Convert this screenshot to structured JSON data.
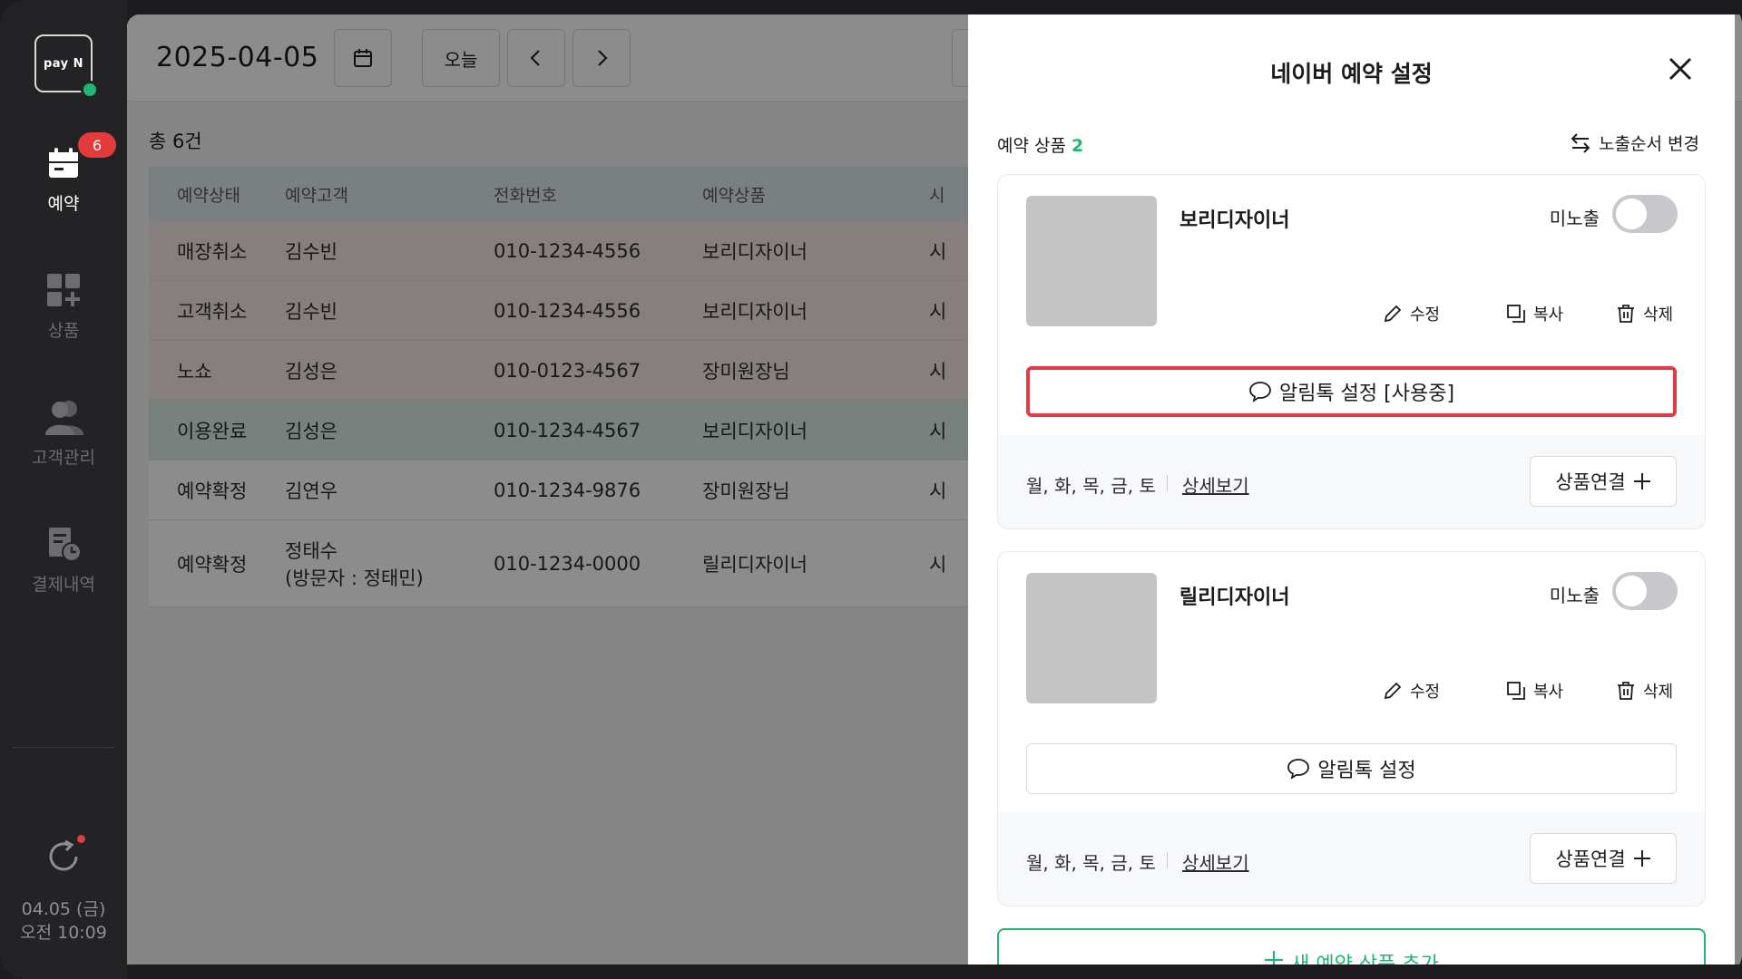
{
  "sidebar": {
    "logo": "pay N",
    "nav": [
      {
        "label": "예약",
        "icon": "calendar-icon",
        "badge": "6",
        "active": true
      },
      {
        "label": "상품",
        "icon": "grid-plus-icon"
      },
      {
        "label": "고객관리",
        "icon": "users-icon"
      },
      {
        "label": "결제내역",
        "icon": "receipt-clock-icon"
      }
    ],
    "date": "04.05 (금)",
    "time": "오전 10:09"
  },
  "main": {
    "date": "2025-04-05",
    "today_label": "오늘",
    "count_label": "총 6건",
    "headers": [
      "예약상태",
      "예약고객",
      "전화번호",
      "예약상품",
      "시"
    ],
    "rows": [
      {
        "status": "매장취소",
        "customer": "김수빈",
        "customer_sub": "",
        "phone": "010-1234-4556",
        "product": "보리디자이너",
        "extra": "시"
      },
      {
        "status": "고객취소",
        "customer": "김수빈",
        "customer_sub": "",
        "phone": "010-1234-4556",
        "product": "보리디자이너",
        "extra": "시"
      },
      {
        "status": "노쇼",
        "customer": "김성은",
        "customer_sub": "",
        "phone": "010-0123-4567",
        "product": "장미원장님",
        "extra": "시"
      },
      {
        "status": "이용완료",
        "customer": "김성은",
        "customer_sub": "",
        "phone": "010-1234-4567",
        "product": "보리디자이너",
        "extra": "시"
      },
      {
        "status": "예약확정",
        "customer": "김연우",
        "customer_sub": "",
        "phone": "010-1234-9876",
        "product": "장미원장님",
        "extra": "시"
      },
      {
        "status": "예약확정",
        "customer": "정태수",
        "customer_sub": "(방문자 : 정태민)",
        "phone": "010-1234-0000",
        "product": "릴리디자이너",
        "extra": "시"
      }
    ]
  },
  "panel": {
    "title": "네이버 예약 설정",
    "section_title": "예약 상품",
    "section_count": "2",
    "order_label": "노출순서 변경",
    "cards": [
      {
        "name": "보리디자이너",
        "visibility_label": "미노출",
        "edit": "수정",
        "copy": "복사",
        "delete": "삭제",
        "notify_label": "알림톡 설정 [사용중]",
        "days": "월, 화, 목, 금, 토",
        "detail": "상세보기",
        "link_label": "상품연결"
      },
      {
        "name": "릴리디자이너",
        "visibility_label": "미노출",
        "edit": "수정",
        "copy": "복사",
        "delete": "삭제",
        "notify_label": "알림톡 설정",
        "days": "월, 화, 목, 금, 토",
        "detail": "상세보기",
        "link_label": "상품연결"
      }
    ],
    "add_label": "새 예약 상품 추가"
  },
  "colors": {
    "accent_green": "#22b573",
    "highlight_red": "#e23b47",
    "badge_red": "#e23b3b",
    "row_cancel": "#f6e5e6",
    "row_done": "#dbece6"
  }
}
